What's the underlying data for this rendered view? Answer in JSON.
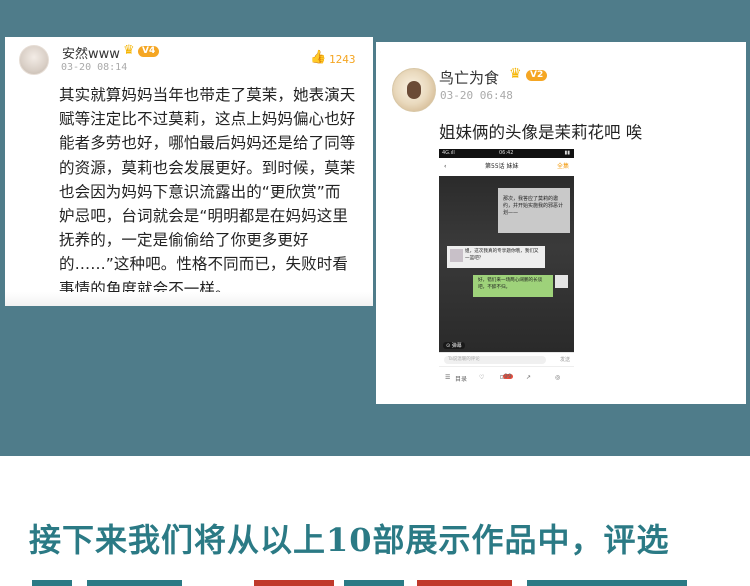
{
  "comment1": {
    "username": "安然www",
    "level": "V4",
    "time": "03-20 08:14",
    "likes": "1243",
    "lines": [
      "其实就算妈妈当年也带走了莫茉，她表演天",
      "赋等注定比不过莫莉，这点上妈妈偏心也好",
      "能者多劳也好，哪怕最后妈妈还是给了同等",
      "的资源，莫莉也会发展更好。到时候，莫茉",
      "也会因为妈妈下意识流露出的“更欣赏”而",
      "妒忌吧，台词就会是“明明都是在妈妈这里",
      "抚养的，一定是偷偷给了你更多更好",
      "的……”这种吧。性格不同而已，失败时看",
      "事情的角度就会不一样。"
    ]
  },
  "comment2": {
    "username": "鸟亡为食",
    "level": "V2",
    "time": "03-20 06:48",
    "text": "姐妹俩的头像是茉莉花吧 唉",
    "screenshot": {
      "status_left": "4G.ıll",
      "status_time": "06:42",
      "status_right": "▮▮",
      "back": "‹",
      "chapter_title": "第55话 妹妹",
      "all_label": "全集",
      "bubble1": "那次，我答应了莫莉的邀约，并开始实施我的邪恶计划——",
      "bubble2": "姐，这次我真的专享题你哦，我们又一篮吧？",
      "bubble3": "好，错们来一场两心阔鹏的长谈吧，不醉不归。",
      "tag": "⊙ 弹幕",
      "comment_placeholder": "Ta说温暖的评论",
      "send": "发送",
      "bottom_items": [
        "☰",
        "目录",
        "♡",
        "⊡",
        "↗",
        "◎"
      ],
      "badge": "99"
    }
  },
  "headline": "接下来我们将从以上10部展示作品中，评选",
  "colors": {
    "teal_band": "#4f7c8a",
    "headline": "#2b7a85",
    "accent_orange": "#f5a623"
  }
}
